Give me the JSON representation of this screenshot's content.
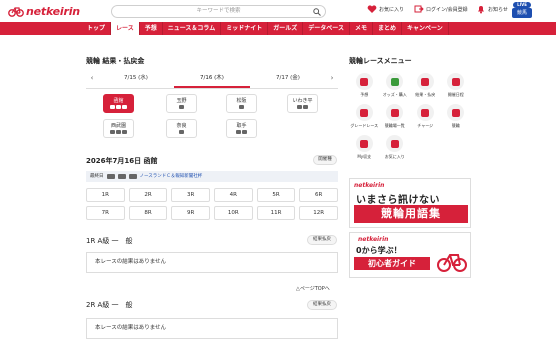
{
  "header": {
    "logo": "netkeirin",
    "search_placeholder": "キーワードで検索",
    "favorites": "お気に入り",
    "login": "ログイン/会員登録",
    "notice": "お知らせ",
    "live_badge": "LIVE",
    "live_label": "競馬"
  },
  "nav": [
    "トップ",
    "レース",
    "予想",
    "ニュース＆コラム",
    "ミッドナイト",
    "ガールズ",
    "データベース",
    "メモ",
    "まとめ",
    "キャンペーン"
  ],
  "left": {
    "section_title": "競輪 結果・払戻金",
    "date_tabs": [
      {
        "label": "7/15 (水)"
      },
      {
        "label": "7/16 (木)"
      },
      {
        "label": "7/17 (金)"
      }
    ],
    "venues": [
      "函館",
      "玉野",
      "松阪",
      "いわき平",
      "西武園",
      "奈良",
      "取手"
    ],
    "race_title": "2026年7月16日 函館",
    "schedule_btn": "開催種",
    "info_label": "最終日",
    "info_link": "ノースランドＣ＆報知新聞社杯",
    "races": [
      "1R",
      "2R",
      "3R",
      "4R",
      "5R",
      "6R",
      "7R",
      "8R",
      "9R",
      "10R",
      "11R",
      "12R"
    ],
    "result1_title": "1R A級 一　般",
    "result1_btn": "結果払戻",
    "result1_msg": "本レースの結果はありません",
    "page_top": "△ページTOPへ",
    "result2_title": "2R A級 一　般",
    "result2_btn": "結果払戻",
    "result2_msg": "本レースの結果はありません"
  },
  "right": {
    "menu_title": "競輪レースメニュー",
    "menu": [
      "予想",
      "オッズ・購入",
      "結果・払戻",
      "開催日程",
      "グレードレース",
      "競輪場一覧",
      "チャージ",
      "競輪",
      "My収支",
      "お気に入り"
    ],
    "banner1_logo": "netkeirin",
    "banner1_line1": "いまさら訊けない",
    "banner1_line2": "競輪用語集",
    "banner2_logo": "netkeirin",
    "banner2_line1": "0から学ぶ！",
    "banner2_line2": "初心者ガイド"
  },
  "colors": {
    "accent": "#d6213a",
    "link": "#1e4fb0"
  }
}
